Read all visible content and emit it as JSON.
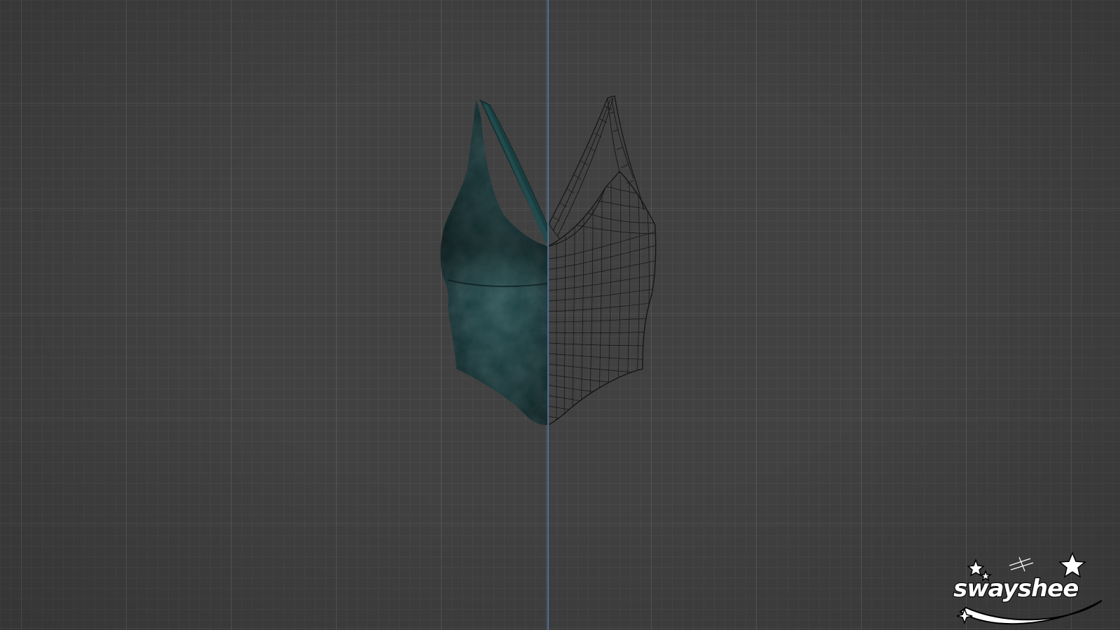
{
  "viewport": {
    "background": "#414141",
    "grid_minor_color": "rgba(255,255,255,0.035)",
    "grid_major_color": "rgba(255,255,255,0.075)",
    "divider_color": "#4d6f96"
  },
  "garment": {
    "left_view": "textured",
    "right_view": "wireframe",
    "texture_color": "#1f4a4d",
    "wire_color": "#111111"
  },
  "logo": {
    "text": "swayshee",
    "color": "#ffffff"
  }
}
